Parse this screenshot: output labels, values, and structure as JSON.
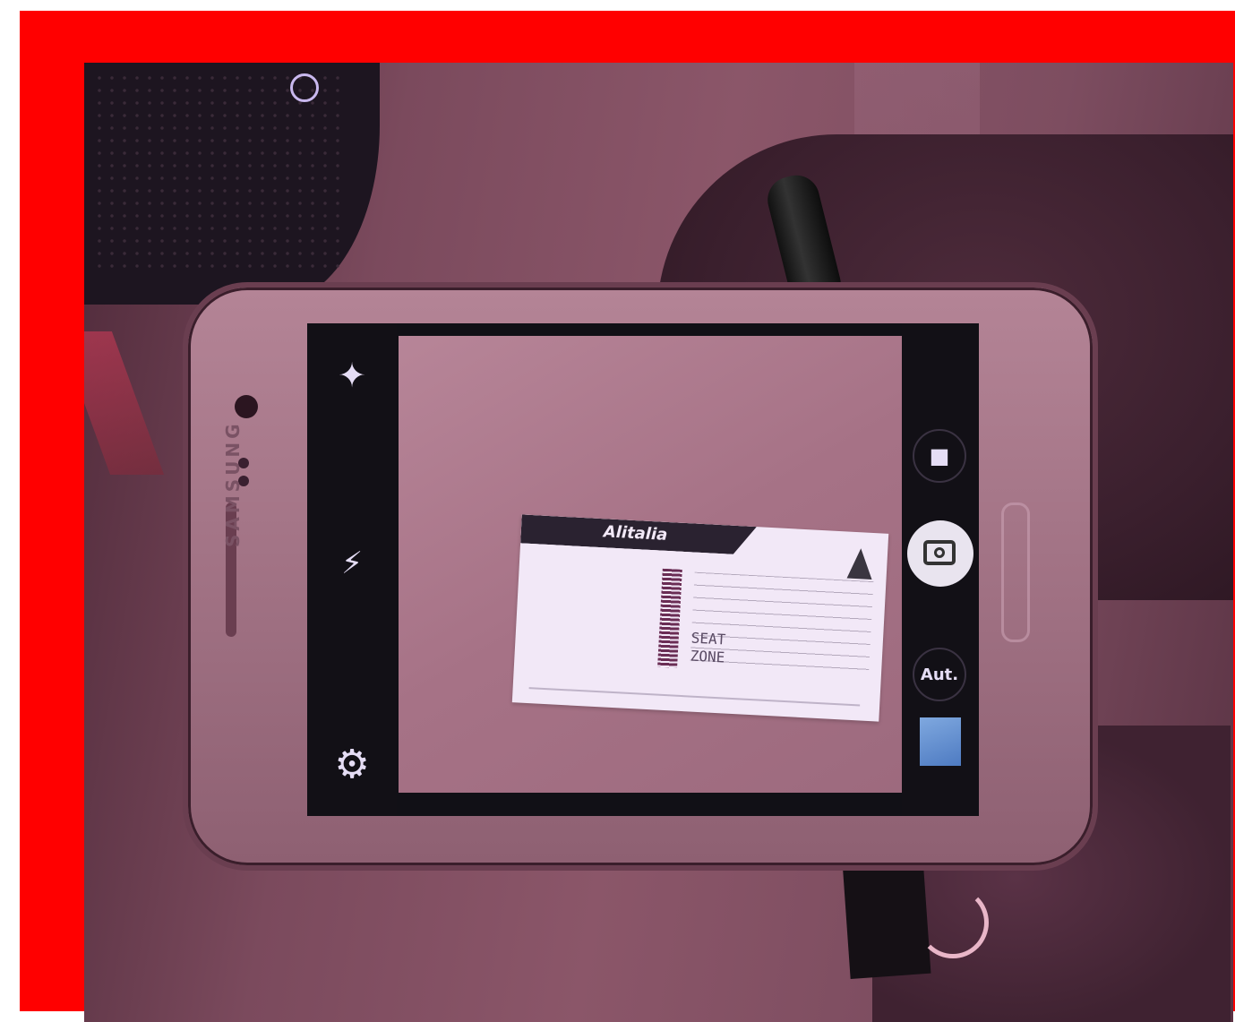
{
  "scene": {
    "frame_color": "#ff0000",
    "phone_brand": "SAMSUNG"
  },
  "camera_app": {
    "icons": {
      "mode": "mode-icon",
      "flash": "flash-off-icon",
      "settings": "gear-icon",
      "video": "video-icon",
      "shutter": "camera-icon",
      "auto_mode_label": "Aut."
    },
    "flash_glyph": "⚡",
    "settings_glyph": "⚙",
    "video_glyph": "■",
    "mode_glyph": "✦"
  },
  "ticket": {
    "airline_logo": "Alitalia",
    "seat_text": "SEAT",
    "zone_text": "ZONE"
  }
}
